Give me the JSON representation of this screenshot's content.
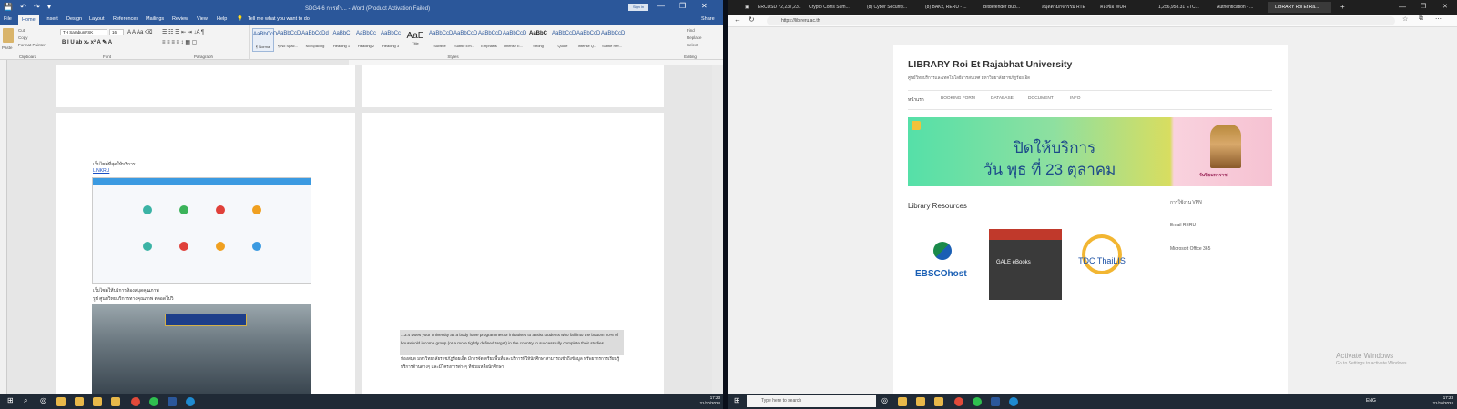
{
  "word": {
    "title": "SDG4-6 การดำ... - Word (Product Activation Failed)",
    "signin": "Sign in",
    "share": "Share",
    "tell_me": "Tell me what you want to do",
    "tabs": [
      "File",
      "Home",
      "Insert",
      "Design",
      "Layout",
      "References",
      "Mailings",
      "Review",
      "View",
      "Help"
    ],
    "active_tab": "Home",
    "clipboard": {
      "paste": "Paste",
      "cut": "Cut",
      "copy": "Copy",
      "format_painter": "Format Painter",
      "label": "Clipboard"
    },
    "font": {
      "name": "TH SarabunPSK",
      "size": "16",
      "label": "Font"
    },
    "paragraph_label": "Paragraph",
    "styles_label": "Styles",
    "styles": [
      {
        "preview": "AaBbCcD",
        "name": "¶ Normal"
      },
      {
        "preview": "AaBbCcD",
        "name": "¶ No Spac..."
      },
      {
        "preview": "AaBbCcDd",
        "name": "No Spacing"
      },
      {
        "preview": "AaBbC",
        "name": "Heading 1"
      },
      {
        "preview": "AaBbCc",
        "name": "Heading 2"
      },
      {
        "preview": "AaBbCc",
        "name": "Heading 3"
      },
      {
        "preview": "AaE",
        "name": "Title"
      },
      {
        "preview": "AaBbCcD",
        "name": "Subtitle"
      },
      {
        "preview": "AaBbCcD",
        "name": "Subtle Em..."
      },
      {
        "preview": "AaBbCcD",
        "name": "Emphasis"
      },
      {
        "preview": "AaBbCcD",
        "name": "Intense E..."
      },
      {
        "preview": "AaBbC",
        "name": "Strong"
      },
      {
        "preview": "AaBbCcD",
        "name": "Quote"
      },
      {
        "preview": "AaBbCcD",
        "name": "Intense Q..."
      },
      {
        "preview": "AaBbCcD",
        "name": "Subtle Ref..."
      }
    ],
    "editing": {
      "find": "Find",
      "replace": "Replace",
      "select": "Select",
      "label": "Editing"
    },
    "doc": {
      "line1": "เว็บไซต์ที่สุดให้บริการ",
      "link1": "LINKRU",
      "line2": "เว็บไซต์ให้บริการห้องสมุดคุณภาพ",
      "line3": "รูป ศูนย์วิทยบริการทางคุณภาพ ตลอดไปวิ",
      "highlight": "1.3.4 Does your university as a body have programmes or initiatives to assist students who fall into the bottom 20% of household income group (or a more tightly defined target) in the country to successfully complete their studies",
      "para": "ห้องสมุด มหาวิทยาลัยราชภัฏร้อยเอ็ด มีการจัดเตรียมพื้นที่และบริการที่ให้นักศึกษาสามารถเข้าถึงข้อมูล ทรัพยากรการเรียนรู้ บริการด้านต่างๆ และมีโครงการต่างๆ ที่ช่วยเหลือนักศึกษา"
    }
  },
  "browser": {
    "tabs": [
      "ERCUSD 72,237,23...",
      "Crypto Coins Sum...",
      "(8) Cyber Security...",
      "(8) BAKx, RERU - ...",
      "Bitdefender Bup...",
      "สมุดตามกิจกรรม RTE",
      "คลังข้อ WUR",
      "1,256,958.31 ETC...",
      "Authentication - ...",
      "LIBRARY Roi Et Ra..."
    ],
    "active_tab_index": 9,
    "url": "https://lib.reru.ac.th"
  },
  "site": {
    "title": "LIBRARY Roi Et Rajabhat University",
    "tagline": "ศูนย์วิทยบริการและเทคโนโลยีสารสนเทศ มหาวิทยาลัยราชภัฏร้อยเอ็ด",
    "nav": [
      "หน้าแรก",
      "BOOKING FORM",
      "DATABASE",
      "DOCUMENT",
      "INFO"
    ],
    "banner": {
      "line1": "ปิดให้บริการ",
      "line2": "วัน พุธ ที่ 23 ตุลาคม",
      "caption": "วันปิยมหาราช"
    },
    "section_title": "Library Resources",
    "resources": [
      "EBSCOhost",
      "GALE eBooks",
      "TDC ThaiLIS"
    ],
    "sidebar_links": [
      "การใช้งาน VPN",
      "Email RERU",
      "Microsoft Office 365"
    ]
  },
  "taskbar_left": {
    "search": "",
    "time": "17:23",
    "date": "21/10/2024"
  },
  "taskbar_right": {
    "search": "Type here to search",
    "lang": "ENG",
    "time": "17:23",
    "date": "21/10/2024"
  },
  "watermark": {
    "line1": "Activate Windows",
    "line2": "Go to Settings to activate Windows."
  }
}
